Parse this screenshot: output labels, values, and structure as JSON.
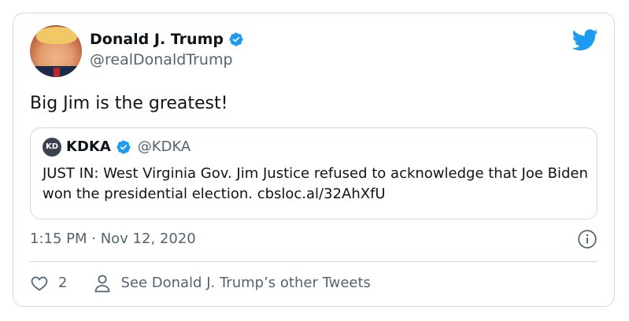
{
  "author": {
    "display_name": "Donald J. Trump",
    "handle": "@realDonaldTrump",
    "verified": true
  },
  "tweet": {
    "text": "Big Jim is the greatest!",
    "timestamp": "1:15 PM · Nov 12, 2020",
    "like_count": "2"
  },
  "quoted_tweet": {
    "display_name": "KDKA",
    "handle": "@KDKA",
    "logo_text": "KD",
    "verified": true,
    "text": "JUST IN: West Virginia Gov. Jim Justice refused to acknowledge that Joe Biden won the presidential election. cbsloc.al/32AhXfU"
  },
  "actions": {
    "other_tweets_label": "See Donald J. Trump’s other Tweets"
  },
  "icons": {
    "brand": "twitter-bird-icon",
    "verified": "verified-badge-icon",
    "info": "info-icon",
    "like": "heart-icon",
    "profile": "person-icon"
  },
  "colors": {
    "twitter_blue": "#1d9bf0",
    "secondary_text": "#536471",
    "border": "#cfd9de"
  }
}
